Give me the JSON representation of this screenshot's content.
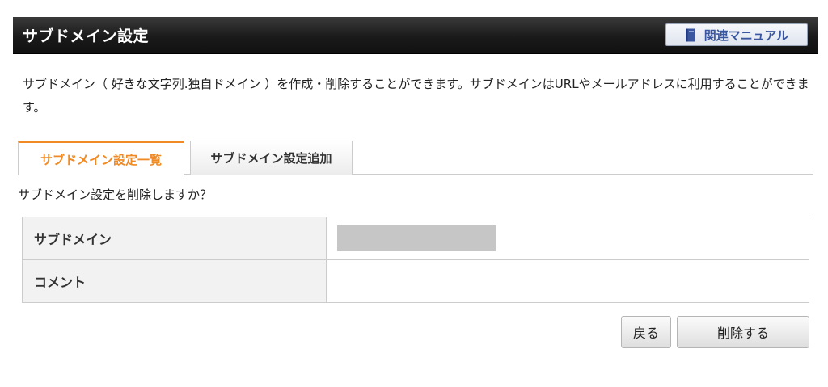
{
  "header": {
    "title": "サブドメイン設定",
    "manual_button_label": "関連マニュアル",
    "manual_icon": "book-icon"
  },
  "description": "サブドメイン（ 好きな文字列.独自ドメイン ）を作成・削除することができます。サブドメインはURLやメールアドレスに利用することができます。",
  "tabs": [
    {
      "label": "サブドメイン設定一覧",
      "active": true
    },
    {
      "label": "サブドメイン設定追加",
      "active": false
    }
  ],
  "question": "サブドメイン設定を削除しますか？",
  "table": {
    "rows": [
      {
        "label": "サブドメイン",
        "value": ""
      },
      {
        "label": "コメント",
        "value": ""
      }
    ]
  },
  "buttons": {
    "back_label": "戻る",
    "delete_label": "削除する"
  },
  "colors": {
    "header_bg": "#1a1a1a",
    "active_tab": "#f08a24",
    "manual_text": "#3a56a0",
    "redacted_box": "#c6c6c6"
  }
}
